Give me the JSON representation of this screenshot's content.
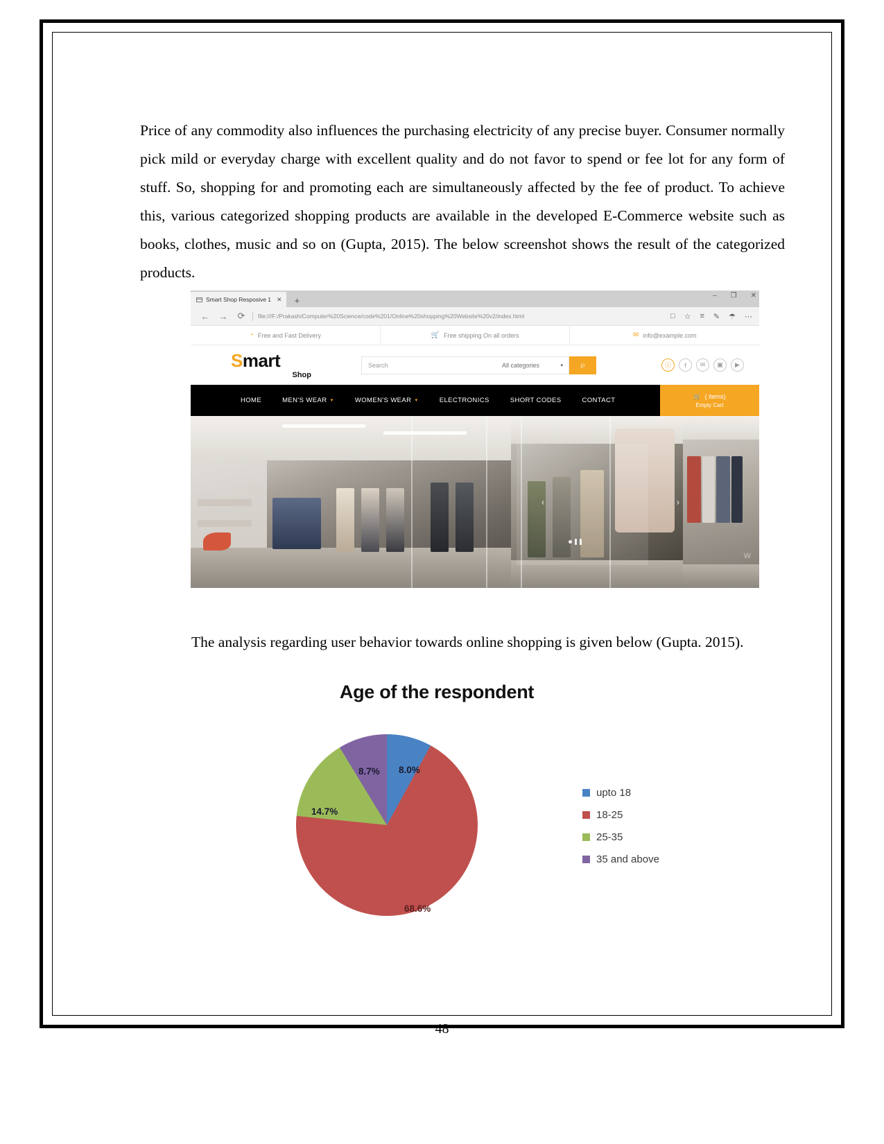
{
  "document": {
    "page_number": "48",
    "paragraphs": [
      "Price of any commodity also influences the purchasing electricity of any precise buyer. Consumer normally pick mild or everyday charge with excellent quality and do not favor to spend or fee lot for any form of stuff. So, shopping for and promoting each are simultaneously affected by the fee of product. To achieve this, various categorized shopping products are available in the developed E-Commerce website such as books, clothes, music and so on (Gupta, 2015). The below screenshot shows the result of the categorized products.",
      "The analysis regarding user behavior towards online shopping is given below (Gupta. 2015)."
    ]
  },
  "browser": {
    "tab": {
      "title": "Smart Shop Resposive 1",
      "close_label": "✕",
      "new_tab_label": "+"
    },
    "window_controls": {
      "minimize": "–",
      "maximize": "❐",
      "close": "✕"
    },
    "toolbar": {
      "back": "←",
      "forward": "→",
      "refresh": "⟳",
      "url": "file:///F:/Prakash/Computer%20Science/code%201/Online%20shopping%20Website%20v2/index.html",
      "reading_view": "□",
      "favorite": "☆",
      "hub": "≡",
      "notes": "✎",
      "share": "☂",
      "more": "⋯"
    }
  },
  "site": {
    "top_info": [
      {
        "icon": "clock-icon",
        "glyph": "◔",
        "text": "Free and Fast Delivery"
      },
      {
        "icon": "cart-icon",
        "glyph": "🛒",
        "text": "Free shipping On all orders"
      },
      {
        "icon": "mail-icon",
        "glyph": "✉",
        "text": "info@example.com"
      }
    ],
    "logo": {
      "first_letter": "S",
      "rest": "mart",
      "sub": "Shop"
    },
    "search": {
      "placeholder": "Search",
      "category_selected": "All categories",
      "caret": "▾",
      "button_icon": "⌕"
    },
    "socials": [
      {
        "name": "account-icon",
        "glyph": "ⓘ"
      },
      {
        "name": "facebook-icon",
        "glyph": "f"
      },
      {
        "name": "twitter-icon",
        "glyph": "✉"
      },
      {
        "name": "instagram-icon",
        "glyph": "▣"
      },
      {
        "name": "youtube-icon",
        "glyph": "▶"
      }
    ],
    "nav": [
      {
        "label": "HOME",
        "has_caret": false
      },
      {
        "label": "MEN'S WEAR",
        "has_caret": true
      },
      {
        "label": "WOMEN'S WEAR",
        "has_caret": true
      },
      {
        "label": "ELECTRONICS",
        "has_caret": false
      },
      {
        "label": "SHORT CODES",
        "has_caret": false
      },
      {
        "label": "CONTACT",
        "has_caret": false
      }
    ],
    "cart": {
      "icon": "🛒",
      "count_label": "( items)",
      "status": "Empty Cart"
    },
    "hero_watermark": "W"
  },
  "chart_data": {
    "type": "pie",
    "title": "Age of the respondent",
    "categories": [
      "upto 18",
      "18-25",
      "25-35",
      "35 and above"
    ],
    "values": [
      8.0,
      68.6,
      14.7,
      8.7
    ],
    "value_labels": [
      "8.0%",
      "68.6%",
      "14.7%",
      "8.7%"
    ],
    "colors": [
      "#4A83C4",
      "#C0504D",
      "#9BBB59",
      "#8064A2"
    ],
    "legend_position": "right",
    "grid": false,
    "xlabel": "",
    "ylabel": ""
  }
}
